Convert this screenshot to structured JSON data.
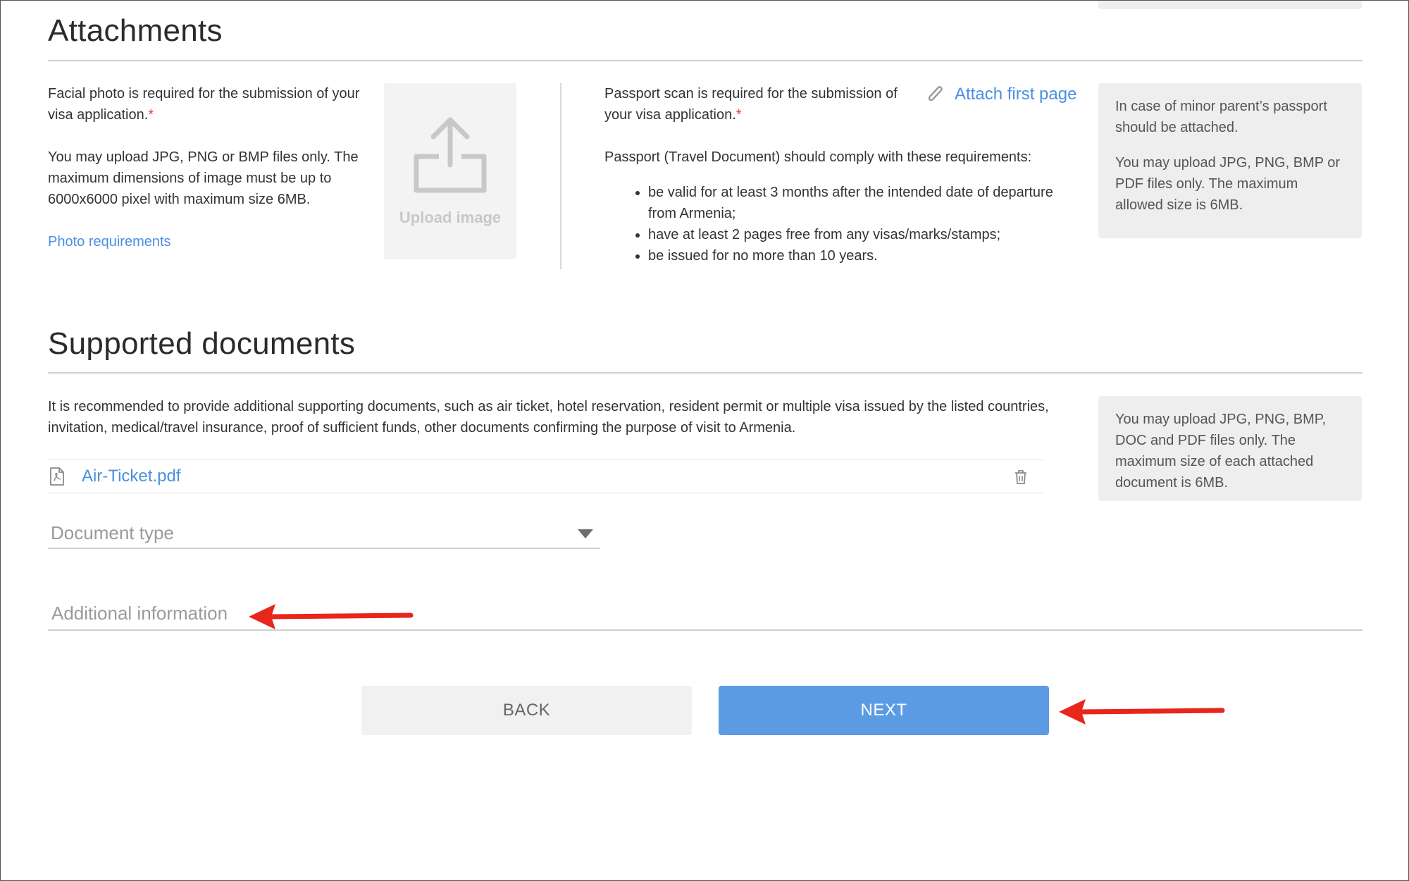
{
  "attachments": {
    "title": "Attachments",
    "photo": {
      "required_text": "Facial photo is required for the submission of your visa application.",
      "asterisk": "*",
      "formats_text": "You may upload JPG, PNG or BMP files only. The maximum dimensions of image must be up to 6000x6000 pixel with maximum size 6MB.",
      "requirements_link": "Photo requirements",
      "upload_label": "Upload image"
    },
    "passport": {
      "required_text": "Passport scan is required for the submission of your visa application.",
      "asterisk": "*",
      "attach_link": "Attach first page",
      "comply_text": "Passport (Travel Document) should comply with these requirements:",
      "requirements": [
        "be valid for at least 3 months after the intended date of departure from Armenia;",
        "have at least 2 pages free from any visas/marks/stamps;",
        "be issued for no more than 10 years."
      ]
    },
    "info_panel": {
      "p1": "In case of minor parent’s passport should be attached.",
      "p2": "You may upload JPG, PNG, BMP or PDF files only. The maximum allowed size is 6MB."
    }
  },
  "supported": {
    "title": "Supported documents",
    "description": "It is recommended to provide additional supporting documents, such as air ticket, hotel reservation, resident permit or multiple visa issued by the listed countries, invitation, medical/travel insurance, proof of sufficient funds, other documents confirming the purpose of visit to Armenia.",
    "info_panel": "You may upload JPG, PNG, BMP, DOC and PDF files only. The maximum size of each attached document is 6MB.",
    "file_name": "Air-Ticket.pdf",
    "document_type_placeholder": "Document type",
    "additional_info_placeholder": "Additional information"
  },
  "buttons": {
    "back": "BACK",
    "next": "NEXT"
  },
  "colors": {
    "accent": "#4a90e2",
    "primary_button": "#5b9be4",
    "required": "#e53935",
    "annotation_arrow": "#e8261c"
  },
  "icons": {
    "upload": "upload-icon",
    "paperclip": "paperclip-icon",
    "pdf": "pdf-file-icon",
    "trash": "trash-icon",
    "dropdown": "caret-down-icon"
  }
}
